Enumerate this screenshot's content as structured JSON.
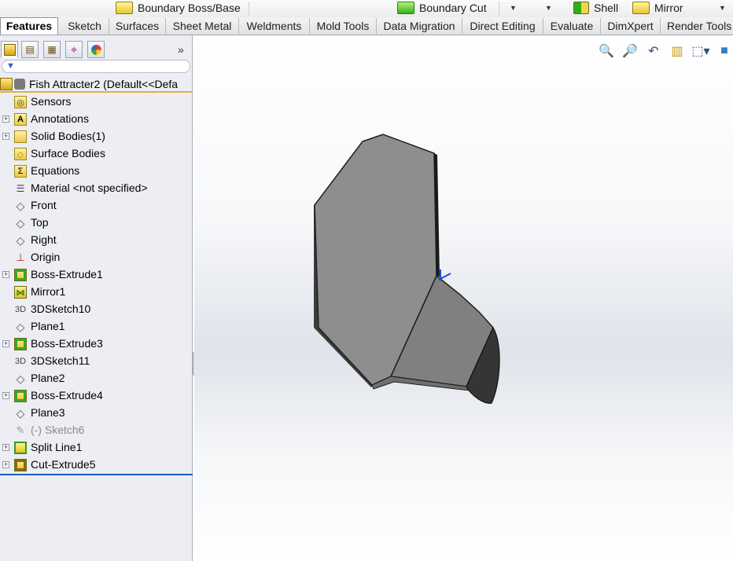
{
  "command_strip": {
    "items": [
      {
        "label": "Boundary Boss/Base",
        "icon": "boundary-boss-icon"
      },
      {
        "label": "Boundary Cut",
        "icon": "boundary-cut-icon"
      },
      {
        "label": "Shell",
        "icon": "shell-icon"
      },
      {
        "label": "Mirror",
        "icon": "mirror-icon"
      }
    ]
  },
  "tabs": [
    {
      "label": "Features",
      "active": true
    },
    {
      "label": "Sketch"
    },
    {
      "label": "Surfaces"
    },
    {
      "label": "Sheet Metal"
    },
    {
      "label": "Weldments"
    },
    {
      "label": "Mold Tools"
    },
    {
      "label": "Data Migration"
    },
    {
      "label": "Direct Editing"
    },
    {
      "label": "Evaluate"
    },
    {
      "label": "DimXpert"
    },
    {
      "label": "Render Tools"
    }
  ],
  "panel": {
    "expand_glyph": "»",
    "root_label": "Fish Attracter2  (Default<<Defa",
    "tree": [
      {
        "label": "Sensors",
        "icon": "sensors-folder-icon",
        "expandable": false
      },
      {
        "label": "Annotations",
        "icon": "annotations-folder-icon",
        "expandable": true
      },
      {
        "label": "Solid Bodies(1)",
        "icon": "solid-bodies-folder-icon",
        "expandable": true
      },
      {
        "label": "Surface Bodies",
        "icon": "surface-bodies-folder-icon",
        "expandable": false
      },
      {
        "label": "Equations",
        "icon": "equations-folder-icon",
        "expandable": false
      },
      {
        "label": "Material <not specified>",
        "icon": "material-icon",
        "expandable": false
      },
      {
        "label": "Front",
        "icon": "plane-icon",
        "expandable": false
      },
      {
        "label": "Top",
        "icon": "plane-icon",
        "expandable": false
      },
      {
        "label": "Right",
        "icon": "plane-icon",
        "expandable": false
      },
      {
        "label": "Origin",
        "icon": "origin-icon",
        "expandable": false
      },
      {
        "label": "Boss-Extrude1",
        "icon": "extrude-icon",
        "expandable": true
      },
      {
        "label": "Mirror1",
        "icon": "mirror-feature-icon",
        "expandable": false
      },
      {
        "label": "3DSketch10",
        "icon": "3d-sketch-icon",
        "expandable": false
      },
      {
        "label": "Plane1",
        "icon": "plane-icon",
        "expandable": false
      },
      {
        "label": "Boss-Extrude3",
        "icon": "extrude-icon",
        "expandable": true
      },
      {
        "label": "3DSketch11",
        "icon": "3d-sketch-icon",
        "expandable": false
      },
      {
        "label": "Plane2",
        "icon": "plane-icon",
        "expandable": false
      },
      {
        "label": "Boss-Extrude4",
        "icon": "extrude-icon",
        "expandable": true
      },
      {
        "label": "Plane3",
        "icon": "plane-icon",
        "expandable": false
      },
      {
        "label": "(-) Sketch6",
        "icon": "sketch-icon",
        "expandable": false,
        "dim": true
      },
      {
        "label": "Split Line1",
        "icon": "split-line-icon",
        "expandable": true
      },
      {
        "label": "Cut-Extrude5",
        "icon": "cut-extrude-icon",
        "expandable": true
      }
    ]
  },
  "view_toolbar": [
    {
      "icon": "zoom-to-fit-icon"
    },
    {
      "icon": "zoom-to-area-icon"
    },
    {
      "icon": "previous-view-icon"
    },
    {
      "icon": "section-view-icon"
    },
    {
      "icon": "view-orientation-icon"
    },
    {
      "icon": "display-style-icon"
    }
  ],
  "colors": {
    "model_face_light": "#8c8c8c",
    "model_face_mid": "#7a7a7a",
    "model_face_dark": "#2e2e2e",
    "rollback_bar": "#1f5cc7"
  }
}
